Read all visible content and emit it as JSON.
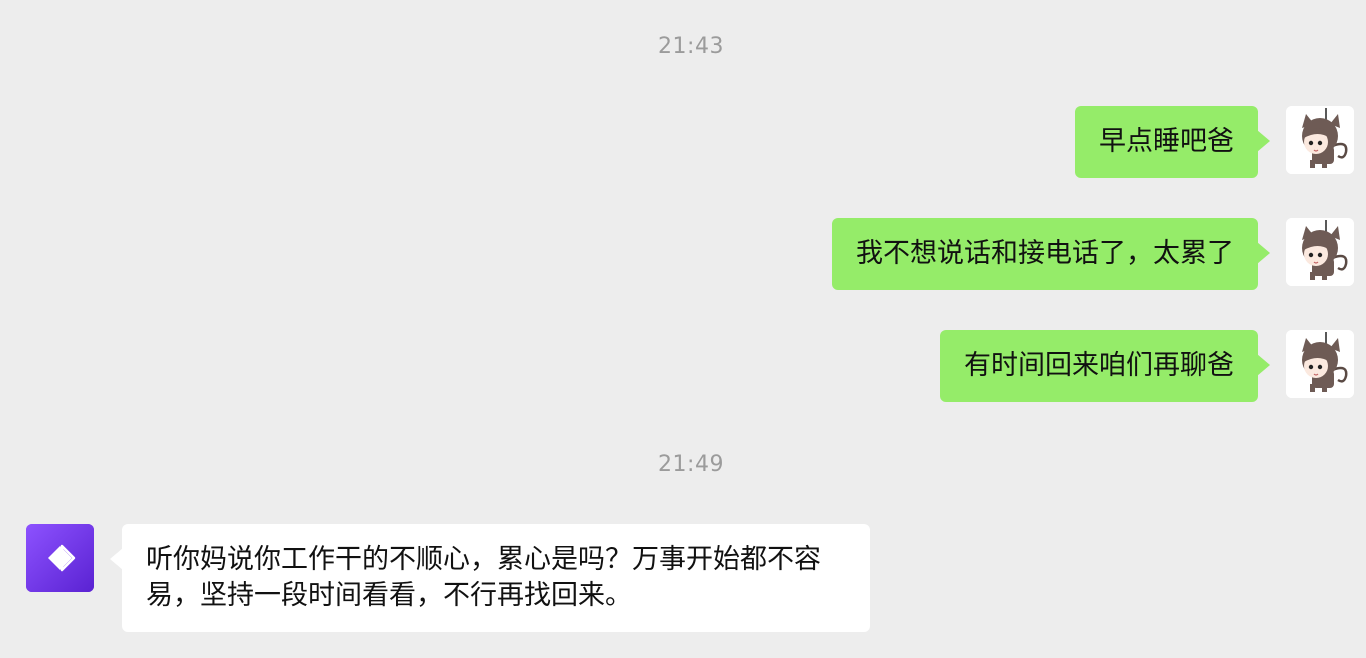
{
  "timestamps": [
    "21:43",
    "21:49"
  ],
  "messages": [
    {
      "sender": "me",
      "text": "早点睡吧爸",
      "avatar_icon": "cat-girl-avatar-icon"
    },
    {
      "sender": "me",
      "text": "我不想说话和接电话了，太累了",
      "avatar_icon": "cat-girl-avatar-icon"
    },
    {
      "sender": "me",
      "text": "有时间回来咱们再聊爸",
      "avatar_icon": "cat-girl-avatar-icon"
    },
    {
      "sender": "other",
      "text": "听你妈说你工作干的不顺心，累心是吗？万事开始都不容易，坚持一段时间看看，不行再找回来。",
      "avatar_icon": "purple-diamond-app-icon"
    }
  ],
  "colors": {
    "background": "#ededed",
    "sent_bubble": "#95ec69",
    "received_bubble": "#ffffff",
    "timestamp_text": "#9b9b9b",
    "avatar_purple": "#6a2ee6"
  }
}
